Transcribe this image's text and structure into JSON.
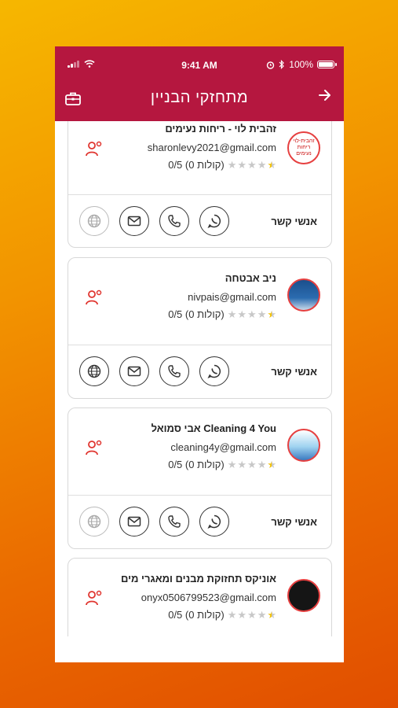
{
  "status_bar": {
    "time": "9:41 AM",
    "battery": "100%"
  },
  "header": {
    "title": "מתחזקי הבניין"
  },
  "contacts_label": "אנשי קשר",
  "cards": [
    {
      "name": "זהבית לוי - ריחות נעימים",
      "email": "sharonlevy2021@gmail.com",
      "rating": "0/5 (0 קולות)",
      "logo_text": "זהבית-לוי ריחות נעימים",
      "website_enabled": false
    },
    {
      "name": "ניב אבטחה",
      "email": "nivpais@gmail.com",
      "rating": "0/5 (0 קולות)",
      "logo_text": "",
      "website_enabled": true
    },
    {
      "name": "אבי סמואל Cleaning 4 You",
      "email": "cleaning4y@gmail.com",
      "rating": "0/5 (0 קולות)",
      "logo_text": "",
      "website_enabled": false
    },
    {
      "name": "אוניקס תחזוקת מבנים ומאגרי מים",
      "email": "onyx0506799523@gmail.com",
      "rating": "0/5 (0 קולות)",
      "logo_text": "",
      "website_enabled": false
    }
  ],
  "colors": {
    "header": "#b5173f",
    "accent_red": "#e0352f",
    "star": "#f2c000"
  }
}
